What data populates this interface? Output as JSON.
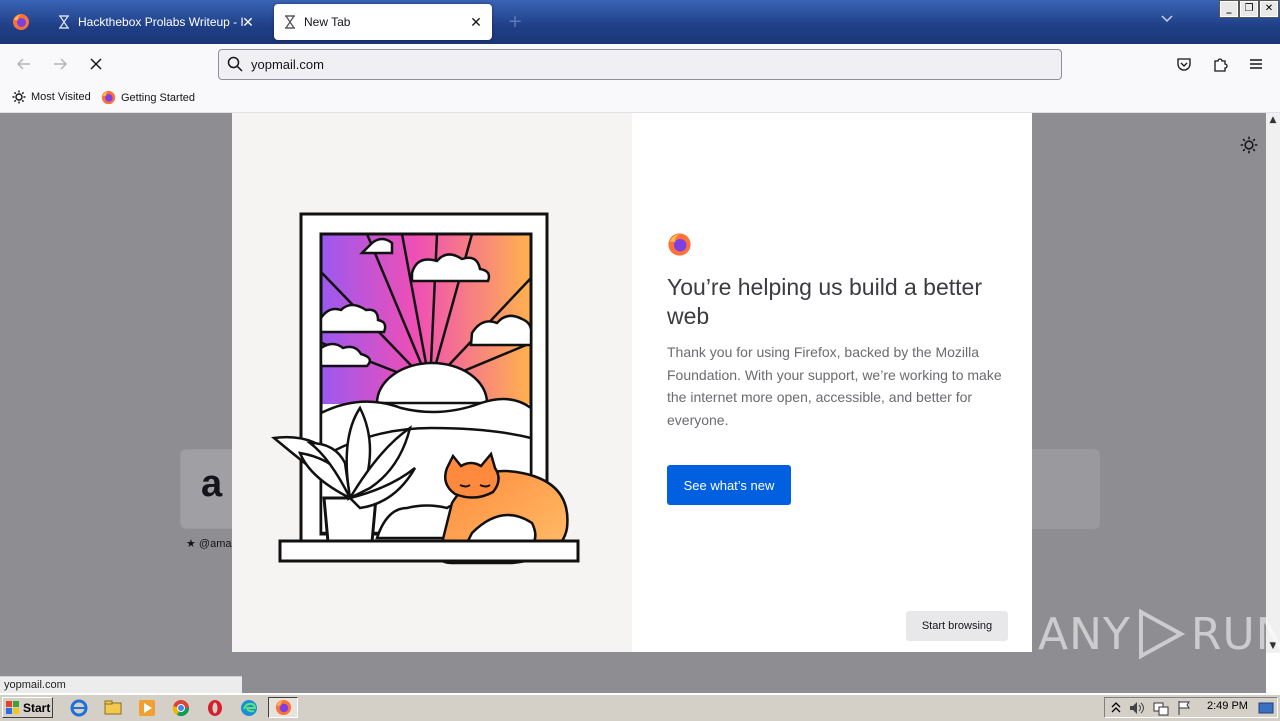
{
  "tabs": [
    {
      "title": "Hackthebox Prolabs Writeup - HTB",
      "icon": "hourglass-icon",
      "active": false
    },
    {
      "title": "New Tab",
      "icon": "hourglass-icon",
      "active": true
    }
  ],
  "navbar": {
    "url_value": "yopmail.com"
  },
  "bookmarks": [
    {
      "label": "Most Visited",
      "icon": "gear-icon"
    },
    {
      "label": "Getting Started",
      "icon": "firefox-icon"
    }
  ],
  "newtab": {
    "tile_letter": "a",
    "tile_label": "★ @ama"
  },
  "modal": {
    "headline": "You’re helping us build a better web",
    "body": "Thank you for using Firefox, backed by the Mozilla Foundation. With your support, we’re working to make the internet more open, accessible, and better for everyone.",
    "primary_button": "See what’s new",
    "secondary_button": "Start browsing"
  },
  "status_bar": "yopmail.com",
  "watermark": {
    "left": "ANY",
    "right": "RUN"
  },
  "taskbar": {
    "start_label": "Start",
    "clock": "2:49 PM"
  },
  "colors": {
    "accent": "#0060df",
    "titlebar": "#1f3f86"
  }
}
